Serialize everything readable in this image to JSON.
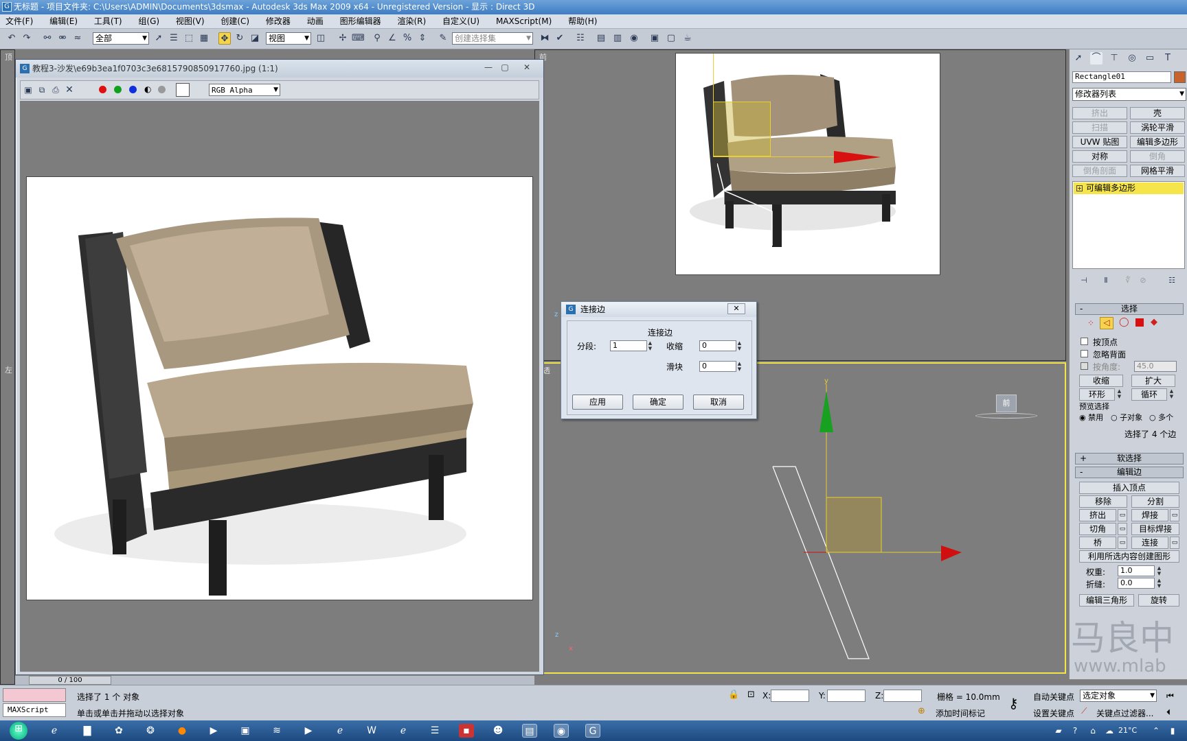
{
  "titlebar": {
    "app_icon": "3dsmax-icon",
    "title": "无标题    - 项目文件夹: C:\\Users\\ADMIN\\Documents\\3dsmax      - Autodesk 3ds Max  2009 x64   - Unregistered Version       - 显示 : Direct 3D"
  },
  "menubar": {
    "items": [
      "文件(F)",
      "编辑(E)",
      "工具(T)",
      "组(G)",
      "视图(V)",
      "创建(C)",
      "修改器",
      "动画",
      "图形编辑器",
      "渲染(R)",
      "自定义(U)",
      "MAXScript(M)",
      "帮助(H)"
    ]
  },
  "toolbar": {
    "selection_filter": "全部",
    "reference_coord": "视图",
    "named_selection_placeholder": "创建选择集"
  },
  "viewports": {
    "top_left_label": "顶",
    "front_label": "前",
    "left_label": "左",
    "perspective_label": "透",
    "view_cube_label": "前",
    "axis_x": "x",
    "axis_y": "y",
    "axis_z": "z"
  },
  "image_window": {
    "title": "教程3-沙发\\e69b3ea1f0703c3e6815790850917760.jpg (1:1)",
    "channel_select": "RGB Alpha",
    "channel_colors": [
      "#e01010",
      "#10a020",
      "#1030e0"
    ]
  },
  "dialog": {
    "title": "连接边",
    "group_title": "连接边",
    "segments_label": "分段:",
    "segments_value": "1",
    "pinch_label": "收缩",
    "pinch_value": "0",
    "slide_label": "滑块",
    "slide_value": "0",
    "apply_label": "应用",
    "ok_label": "确定",
    "cancel_label": "取消"
  },
  "command_panel": {
    "object_name": "Rectangle01",
    "object_color": "#c8642a",
    "modifier_list": "修改器列表",
    "modifier_buttons": [
      "挤出",
      "壳",
      "扫描",
      "涡轮平滑",
      "UVW 贴图",
      "编辑多边形",
      "对称",
      "倒角",
      "倒角剖面",
      "网格平滑"
    ],
    "stack_item": "可编辑多边形",
    "selection": {
      "title": "选择",
      "by_vertex": "按顶点",
      "ignore_backfacing": "忽略背面",
      "by_angle": "按角度:",
      "angle_value": "45.0",
      "shrink": "收缩",
      "grow": "扩大",
      "ring": "环形",
      "loop": "循环",
      "preview_title": "预览选择",
      "preview_off": "禁用",
      "preview_subobj": "子对象",
      "preview_multi": "多个",
      "status": "选择了 4 个边"
    },
    "soft_selection": "软选择",
    "edit_edges": {
      "title": "编辑边",
      "insert_vertex": "插入顶点",
      "remove": "移除",
      "split": "分割",
      "extrude": "挤出",
      "weld": "焊接",
      "chamfer": "切角",
      "target_weld": "目标焊接",
      "bridge": "桥",
      "connect": "连接",
      "create_shape": "利用所选内容创建图形",
      "weight_label": "权重:",
      "weight_value": "1.0",
      "crease_label": "折缝:",
      "crease_value": "0.0",
      "edit_tri": "编辑三角形",
      "turn": "旋转"
    },
    "watermark": "马良中",
    "watermark_url": "www.mlab"
  },
  "timeline": {
    "frame": "0 / 100"
  },
  "statusbar": {
    "maxscript": "MAXScript",
    "selected": "选择了 1 个 对象",
    "prompt": "单击或单击并拖动以选择对象",
    "x_label": "X:",
    "y_label": "Y:",
    "z_label": "Z:",
    "grid": "栅格 = 10.0mm",
    "add_time_tag": "添加时间标记",
    "auto_key": "自动关键点",
    "set_key": "设置关键点",
    "selected_obj": "选定对象",
    "key_filters": "关键点过滤器..."
  },
  "taskbar": {
    "temperature": "21°C"
  }
}
